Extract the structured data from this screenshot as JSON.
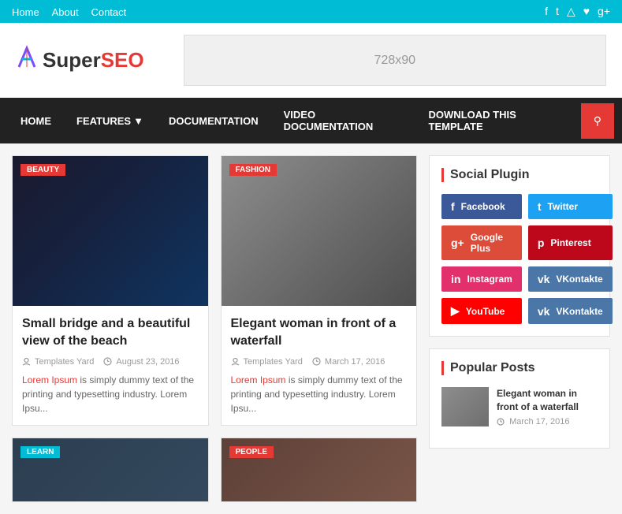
{
  "topbar": {
    "nav": [
      "Home",
      "About",
      "Contact"
    ],
    "icons": [
      "f",
      "t",
      "i",
      "p",
      "g+"
    ]
  },
  "header": {
    "logo_super": "Super",
    "logo_seo": "SEO",
    "ad_text": "728x90"
  },
  "nav": {
    "items": [
      {
        "label": "HOME",
        "id": "home"
      },
      {
        "label": "FEATURES",
        "id": "features",
        "has_arrow": true
      },
      {
        "label": "DOCUMENTATION",
        "id": "docs"
      },
      {
        "label": "VIDEO DOCUMENTATION",
        "id": "videodocs"
      },
      {
        "label": "DOWNLOAD THIS TEMPLATE",
        "id": "download"
      }
    ]
  },
  "articles": [
    {
      "badge": "BEAUTY",
      "badge_class": "badge-beauty",
      "img_class": "img-dark",
      "title": "Small bridge and a beautiful view of the beach",
      "author": "Templates Yard",
      "date": "August 23, 2016",
      "excerpt": "Lorem Ipsum is simply dummy text of the printing and typesetting industry. Lorem Ipsu..."
    },
    {
      "badge": "FASHION",
      "badge_class": "badge-fashion",
      "img_class": "img-woman",
      "title": "Elegant woman in front of a waterfall",
      "author": "Templates Yard",
      "date": "March 17, 2016",
      "excerpt": "Lorem Ipsum is simply dummy text of the printing and typesetting industry. Lorem Ipsu..."
    }
  ],
  "bottom_articles": [
    {
      "badge": "LEARN",
      "badge_class": "badge-learn",
      "img_class": "img-bottom1"
    },
    {
      "badge": "PEOPLE",
      "badge_class": "badge-people",
      "img_class": "img-bottom2"
    }
  ],
  "sidebar": {
    "social_plugin_title": "Social Plugin",
    "social_buttons": [
      {
        "label": "Facebook",
        "class": "sb-facebook",
        "icon": "f"
      },
      {
        "label": "Twitter",
        "class": "sb-twitter",
        "icon": "t"
      },
      {
        "label": "Google Plus",
        "class": "sb-googleplus",
        "icon": "g+"
      },
      {
        "label": "Pinterest",
        "class": "sb-pinterest",
        "icon": "p"
      },
      {
        "label": "Instagram",
        "class": "sb-instagram",
        "icon": "in"
      },
      {
        "label": "VKontakte",
        "class": "sb-vkontakte",
        "icon": "vk"
      },
      {
        "label": "YouTube",
        "class": "sb-youtube",
        "icon": "▶"
      },
      {
        "label": "VKontakte",
        "class": "sb-vkontakte2",
        "icon": "vk"
      }
    ],
    "popular_posts_title": "Popular Posts",
    "popular_posts": [
      {
        "title": "Elegant woman in front of a waterfall",
        "date": "March 17, 2016",
        "img_class": "img-thumb"
      }
    ]
  }
}
